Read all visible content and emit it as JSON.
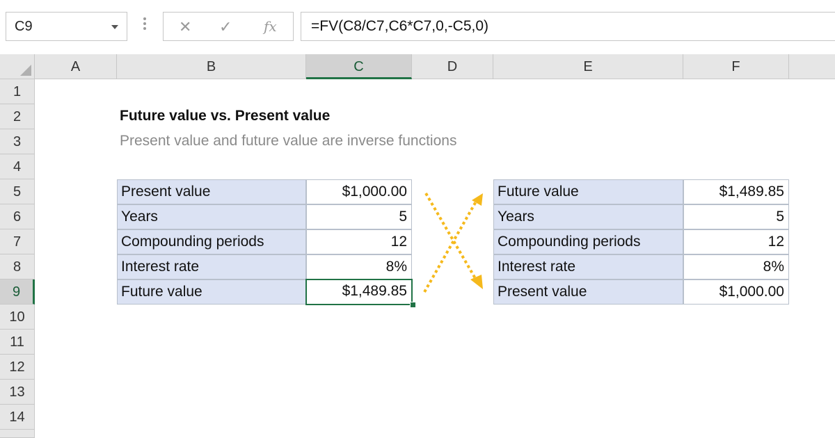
{
  "formula_bar": {
    "name_box": "C9",
    "cancel_icon": "✕",
    "enter_icon": "✓",
    "function_icon": "fx",
    "formula": "=FV(C8/C7,C6*C7,0,-C5,0)"
  },
  "columns": [
    "A",
    "B",
    "C",
    "D",
    "E",
    "F"
  ],
  "rows": [
    "1",
    "2",
    "3",
    "4",
    "5",
    "6",
    "7",
    "8",
    "9",
    "10",
    "11",
    "12",
    "13",
    "14"
  ],
  "sheet": {
    "title": "Future value vs. Present value",
    "subtitle": "Present value and future value are inverse functions",
    "left_table": [
      {
        "label": "Present value",
        "value": "$1,000.00"
      },
      {
        "label": "Years",
        "value": "5"
      },
      {
        "label": "Compounding periods",
        "value": "12"
      },
      {
        "label": "Interest rate",
        "value": "8%"
      },
      {
        "label": "Future value",
        "value": "$1,489.85"
      }
    ],
    "right_table": [
      {
        "label": "Future value",
        "value": "$1,489.85"
      },
      {
        "label": "Years",
        "value": "5"
      },
      {
        "label": "Compounding periods",
        "value": "12"
      },
      {
        "label": "Interest rate",
        "value": "8%"
      },
      {
        "label": "Present value",
        "value": "$1,000.00"
      }
    ]
  },
  "colors": {
    "accent_green": "#217346",
    "label_fill": "#dbe2f3",
    "arrow_orange": "#f5b91c"
  },
  "icons": [
    "chevron-down-icon",
    "cancel-icon",
    "checkmark-icon",
    "function-icon",
    "select-all-icon",
    "crossing-arrows-icon"
  ]
}
